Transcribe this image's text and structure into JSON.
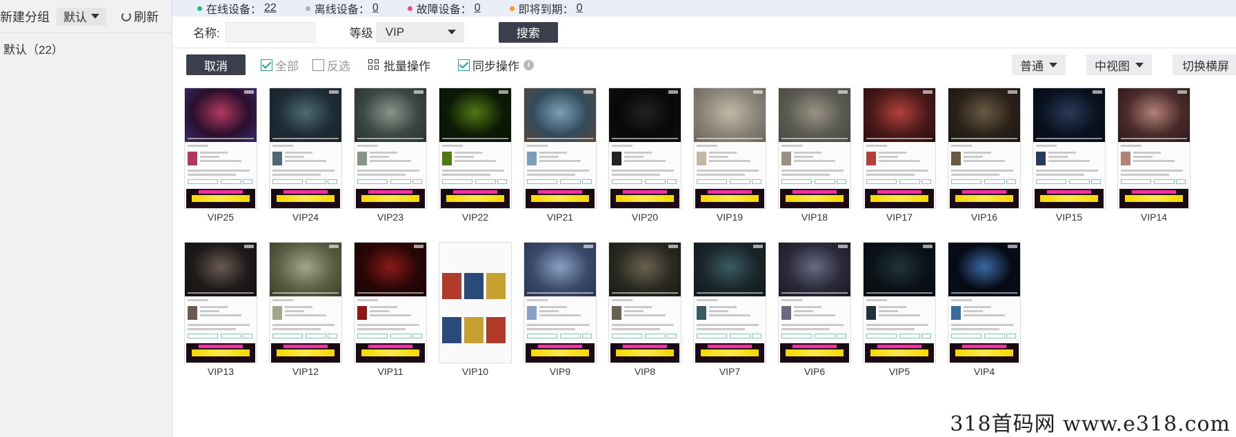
{
  "left_panel": {
    "new_group": "新建分组",
    "group_select": "默认",
    "refresh": "刷新",
    "group_item": "默认（22）"
  },
  "status": {
    "online_label": "在线设备：",
    "online_count": "22",
    "offline_label": "离线设备：",
    "offline_count": "0",
    "fault_label": "故障设备：",
    "fault_count": "0",
    "expiring_label": "即将到期：",
    "expiring_count": "0",
    "colors": {
      "online": "#1fbf7a",
      "offline": "#b0b0b0",
      "fault": "#f0506e",
      "expiring": "#ff9a1f"
    }
  },
  "search": {
    "name_label": "名称:",
    "name_value": "",
    "level_label": "等级",
    "level_value": "VIP",
    "search_button": "搜索"
  },
  "actions": {
    "cancel": "取消",
    "select_all": "全部",
    "invert": "反选",
    "batch": "批量操作",
    "sync": "同步操作",
    "view_mode": "普通",
    "view_size": "中视图",
    "landscape": "切换横屏"
  },
  "devices": [
    {
      "label": "VIP25",
      "scene": [
        "#2a0f2e",
        "#b2395e",
        "#3a2a6a"
      ],
      "type": "video"
    },
    {
      "label": "VIP24",
      "scene": [
        "#1e2c36",
        "#4d6a72",
        "#1a2226"
      ],
      "type": "video"
    },
    {
      "label": "VIP23",
      "scene": [
        "#3a4742",
        "#8a948c",
        "#2a3230"
      ],
      "type": "video"
    },
    {
      "label": "VIP22",
      "scene": [
        "#0d1a06",
        "#4f7a12",
        "#0a1204"
      ],
      "type": "video"
    },
    {
      "label": "VIP21",
      "scene": [
        "#324a5a",
        "#7aa0b8",
        "#5a4a3a"
      ],
      "type": "video"
    },
    {
      "label": "VIP20",
      "scene": [
        "#080808",
        "#222222",
        "#111111"
      ],
      "type": "video"
    },
    {
      "label": "VIP19",
      "scene": [
        "#8a8478",
        "#c2b8a6",
        "#6a6458"
      ],
      "type": "video"
    },
    {
      "label": "VIP18",
      "scene": [
        "#5a5a52",
        "#9a9284",
        "#4a4842"
      ],
      "type": "video"
    },
    {
      "label": "VIP17",
      "scene": [
        "#4a1a1a",
        "#b2423a",
        "#2a0a0a"
      ],
      "type": "video"
    },
    {
      "label": "VIP16",
      "scene": [
        "#2a221a",
        "#6a5a44",
        "#1a1610"
      ],
      "type": "video"
    },
    {
      "label": "VIP15",
      "scene": [
        "#0a1220",
        "#2a3a5a",
        "#060a12"
      ],
      "type": "video"
    },
    {
      "label": "VIP14",
      "scene": [
        "#4a2a2a",
        "#b28276",
        "#2a1a1a"
      ],
      "type": "video"
    },
    {
      "label": "VIP13",
      "scene": [
        "#1e1a1a",
        "#6a5a52",
        "#141010"
      ],
      "type": "video"
    },
    {
      "label": "VIP12",
      "scene": [
        "#5a6042",
        "#a2a68a",
        "#3a3e2a"
      ],
      "type": "video"
    },
    {
      "label": "VIP11",
      "scene": [
        "#2a0606",
        "#8a1a1a",
        "#140404"
      ],
      "type": "video"
    },
    {
      "label": "VIP10",
      "scene": [
        "#b23a2a",
        "#2a4a7a",
        "#c8a030"
      ],
      "type": "list"
    },
    {
      "label": "VIP9",
      "scene": [
        "#3a4a6a",
        "#8aa0c2",
        "#2a3450"
      ],
      "type": "video"
    },
    {
      "label": "VIP8",
      "scene": [
        "#2a2a22",
        "#6a6250",
        "#1a1a14"
      ],
      "type": "video"
    },
    {
      "label": "VIP7",
      "scene": [
        "#1a262a",
        "#3a5a62",
        "#101a1c"
      ],
      "type": "video"
    },
    {
      "label": "VIP6",
      "scene": [
        "#2a2a3a",
        "#6a6a82",
        "#1a1a26"
      ],
      "type": "video"
    },
    {
      "label": "VIP5",
      "scene": [
        "#0a1218",
        "#22323a",
        "#060a0e"
      ],
      "type": "video"
    },
    {
      "label": "VIP4",
      "scene": [
        "#060a14",
        "#3a6aa2",
        "#0a0e1a"
      ],
      "type": "video"
    }
  ],
  "watermark": "318首码网  www.e318.com"
}
